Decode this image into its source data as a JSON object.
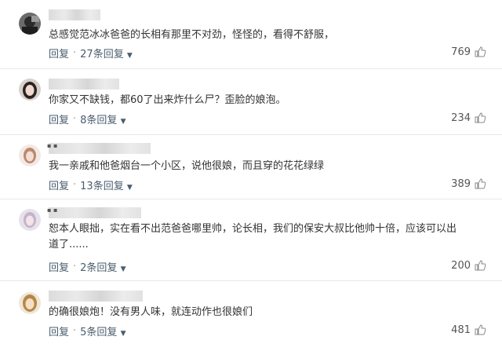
{
  "comments": [
    {
      "text": "总感觉范冰冰爸爸的长相有那里不对劲，怪怪的，看得不舒服，",
      "reply_label": "回复",
      "separator": "·",
      "replies": "27条回复",
      "likes": "769"
    },
    {
      "text": "你家又不缺钱，都60了出来炸什么尸？歪脸的娘泡。",
      "reply_label": "回复",
      "separator": "·",
      "replies": "8条回复",
      "likes": "234"
    },
    {
      "text": "我一亲戚和他爸烟台一个小区，说他很娘，而且穿的花花绿绿",
      "reply_label": "回复",
      "separator": "·",
      "replies": "13条回复",
      "likes": "389"
    },
    {
      "text": "恕本人眼拙，实在看不出范爸爸哪里帅，论长相，我们的保安大叔比他帅十倍，应该可以出道了......",
      "reply_label": "回复",
      "separator": "·",
      "replies": "2条回复",
      "likes": "200"
    },
    {
      "text": "的确很娘炮！没有男人味，就连动作也很娘们",
      "reply_label": "回复",
      "separator": "·",
      "replies": "5条回复",
      "likes": "481"
    }
  ],
  "icons": {
    "chevron": "chevron-down-icon",
    "like": "thumbs-up-icon"
  },
  "colors": {
    "link": "#4a5c6e",
    "text": "#333333",
    "divider": "#e8e8e8"
  }
}
